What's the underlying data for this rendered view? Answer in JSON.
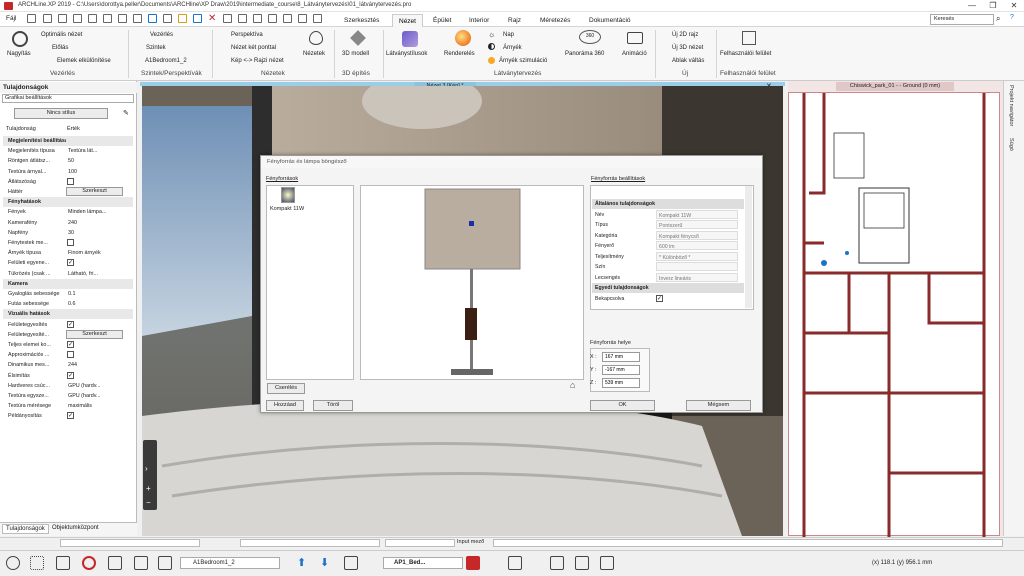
{
  "window": {
    "title": "ARCHLine.XP 2019 - C:\\Users\\dorottya.peller\\Documents\\ARCHline\\XP Draw\\2019\\intermediate_course\\8_Látványtervezés\\01_látványtervezés.pro",
    "minimize": "—",
    "maximize": "❐",
    "close": "✕"
  },
  "menu": {
    "file": "Fájl",
    "tabs": [
      "Szerkesztés",
      "Nézet",
      "Épület",
      "Interior",
      "Rajz",
      "Méretezés",
      "Dokumentáció"
    ],
    "active": "Nézet",
    "search_placeholder": "Keresés"
  },
  "ribbon": {
    "nagyitas": "Nagyítás",
    "optimal": "Optimális nézet",
    "elolas": "Előlás",
    "elemek": "Elemek elkülönítése",
    "vezerles": "Vezérlés",
    "szintek": "Szintek",
    "level": "A1Bedroom1_2",
    "perspektiva": "Perspektíva",
    "ket_pont": "Nézet két ponttal",
    "kep_rajzi": "Kép <-> Rajzi nézet",
    "nezetek": "Nézetek",
    "modell3d": "3D modell",
    "latvanystilusok": "Látványstílusok",
    "renderelés": "Renderelés",
    "nap": "Nap",
    "arnyek": "Árnyék",
    "arnyek_szim": "Árnyék szimuláció",
    "panorama": "Panoráma 360",
    "animacio": "Animáció",
    "uj2d": "Új 2D rajz",
    "uj3d": "Új 3D nézet",
    "ablak_valtas": "Ablak váltás",
    "felhasznaloi": "Felhasználói felület",
    "groups": [
      "Vezérlés",
      "Szintek/Perspektívák",
      "Nézetek",
      "3D építés",
      "Látványtervezés",
      "Új",
      "Felhasználói felület"
    ]
  },
  "left_panel": {
    "title": "Tulajdonságok",
    "dropdown": "Grafikai beállítások",
    "nincs_stilus": "Nincs stílus",
    "col_key": "Tulajdonság",
    "col_val": "Érték",
    "rows": [
      {
        "k": "Megjelenítési beállítása (3D)",
        "sec": true
      },
      {
        "k": "Megjelenítés típusa",
        "v": "Textúra lát..."
      },
      {
        "k": "Röntgen átlátsz...",
        "v": "50"
      },
      {
        "k": "Textúra árnyal...",
        "v": "100"
      },
      {
        "k": "Átlátszóság",
        "chk": ""
      },
      {
        "k": "Háttér",
        "btn": "Szerkeszt"
      },
      {
        "k": "Fényhatások",
        "sec": true
      },
      {
        "k": "Fények",
        "v": "Minden lámpa..."
      },
      {
        "k": "Kamerafény",
        "v": "240"
      },
      {
        "k": "Napfény",
        "v": "30"
      },
      {
        "k": "Fénytestek me...",
        "chk": ""
      },
      {
        "k": "Árnyék típusa",
        "v": "Finom árnyék"
      },
      {
        "k": "Felületi egyene...",
        "chk": "✓"
      },
      {
        "k": "Tükrözés (csak ...",
        "v": "Látható, fri..."
      },
      {
        "k": "Kamera",
        "sec": true
      },
      {
        "k": "Gyaloglás sebessége",
        "v": "0.1"
      },
      {
        "k": "Futás sebessége",
        "v": "0.6"
      },
      {
        "k": "Vizuális hatások",
        "sec": true
      },
      {
        "k": "Felületegyesítés",
        "chk": "✓"
      },
      {
        "k": "Felületegyesíté...",
        "btn": "Szerkeszt"
      },
      {
        "k": "Teljes elemei ko...",
        "chk": "✓"
      },
      {
        "k": "Approximációs ...",
        "chk": ""
      },
      {
        "k": "Dinamikus mes...",
        "v": "244"
      },
      {
        "k": "Élsimítás",
        "chk": "✓"
      },
      {
        "k": "Hardveres csúc...",
        "v": "GPU (hardv..."
      },
      {
        "k": "Textúra egysze...",
        "v": "GPU (hardv..."
      },
      {
        "k": "Textúra mérésege",
        "v": "maximális"
      },
      {
        "k": "Példányosítás",
        "chk": "✓"
      }
    ],
    "tabs": [
      "Tulajdonságok",
      "Objektumközpont"
    ]
  },
  "view3d": {
    "title": "Nézet 3 [Kép] *"
  },
  "plan": {
    "title": "Chiswick_park_01 - - Ground (0 mm)"
  },
  "right_sidebar": {
    "items": [
      "Projekt navigátor",
      "Súgó"
    ]
  },
  "dialog": {
    "title": "Fényforrás és lámpa böngésző",
    "list_title": "Fényforrások",
    "item": "Kompakt 11W",
    "settings_title": "Fényforrás beállítások",
    "rows": [
      {
        "k": "Általános tulajdonságok",
        "sec": true
      },
      {
        "k": "Név",
        "v": "Kompakt 11W"
      },
      {
        "k": "Típus",
        "v": "Pontszerű"
      },
      {
        "k": "Kategória",
        "v": "Kompakt fénycső"
      },
      {
        "k": "Fényerő",
        "v": "600 lm"
      },
      {
        "k": "Teljesítmény",
        "v": "* Különböző *"
      },
      {
        "k": "Szín",
        "v": ""
      },
      {
        "k": "Lecsengés",
        "v": "Inverz lineáris"
      },
      {
        "k": "Egyedi tulajdonságok",
        "sec": true
      },
      {
        "k": "Bekapcsolva",
        "chk": "✓"
      }
    ],
    "pos_title": "Fényforrás helye",
    "x_label": "X :",
    "y_label": "Y :",
    "z_label": "Z :",
    "x": "167 mm",
    "y": "-167 mm",
    "z": "539 mm",
    "csere": "Cserélés",
    "hozzaad": "Hozzáad",
    "torol": "Töröl",
    "ok": "OK",
    "megsem": "Mégsem"
  },
  "status": {
    "input_mezo": "Input mező",
    "coords": "(x) 118.1  (y) 956.1 mm",
    "level": "A1Bedroom1_2",
    "layer": "AP1_Bed..."
  }
}
